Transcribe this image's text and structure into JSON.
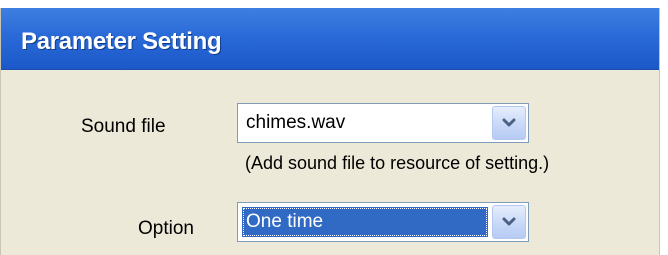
{
  "dialog": {
    "title": "Parameter Setting"
  },
  "sound_file": {
    "label": "Sound file",
    "value": "chimes.wav",
    "hint": "(Add sound file to resource of setting.)",
    "icon": "chevron-down-icon"
  },
  "option": {
    "label": "Option",
    "value": "One time",
    "icon": "chevron-down-icon"
  },
  "colors": {
    "title_bar": "#2a6ad8",
    "panel": "#ece9d8",
    "selection": "#316ac5"
  }
}
